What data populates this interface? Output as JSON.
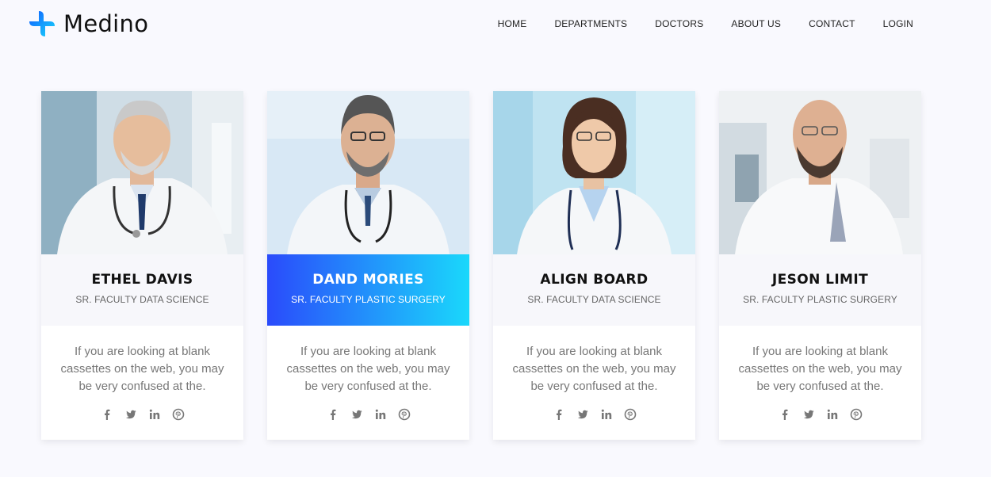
{
  "brand": {
    "name": "Medino",
    "logo_icon": "plus-cross-icon",
    "colors": {
      "blue": "#1a73ff",
      "cyan": "#1ad8fb"
    }
  },
  "nav": {
    "items": [
      {
        "label": "HOME"
      },
      {
        "label": "DEPARTMENTS"
      },
      {
        "label": "DOCTORS"
      },
      {
        "label": "ABOUT US"
      },
      {
        "label": "CONTACT"
      },
      {
        "label": "LOGIN"
      }
    ]
  },
  "doctors": [
    {
      "name": "ETHEL DAVIS",
      "role": "SR. FACULTY DATA SCIENCE",
      "description": "If you are looking at blank cassettes on the web, you may be very confused at the.",
      "highlighted": false
    },
    {
      "name": "DAND MORIES",
      "role": "SR. FACULTY PLASTIC SURGERY",
      "description": "If you are looking at blank cassettes on the web, you may be very confused at the.",
      "highlighted": true
    },
    {
      "name": "ALIGN BOARD",
      "role": "SR. FACULTY DATA SCIENCE",
      "description": "If you are looking at blank cassettes on the web, you may be very confused at the.",
      "highlighted": false
    },
    {
      "name": "JESON LIMIT",
      "role": "SR. FACULTY PLASTIC SURGERY",
      "description": "If you are looking at blank cassettes on the web, you may be very confused at the.",
      "highlighted": false
    }
  ],
  "social_icons": [
    "facebook-icon",
    "twitter-icon",
    "linkedin-icon",
    "pinterest-icon"
  ],
  "highlight_gradient": [
    "#2a4bfb",
    "#1ad8fb"
  ]
}
